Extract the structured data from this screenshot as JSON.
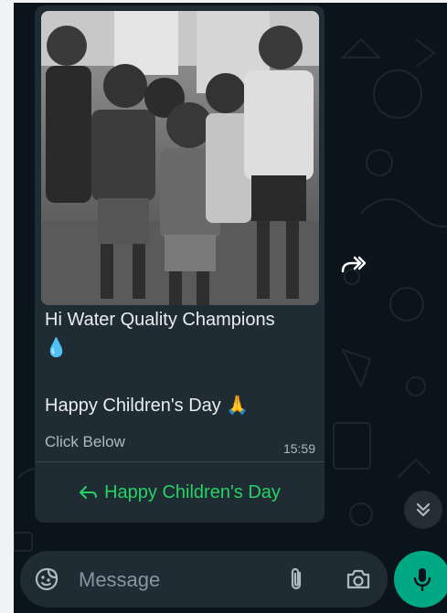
{
  "message": {
    "line1": "Hi Water Quality Champions",
    "line2_emoji": "💧",
    "line3": "Happy Children's Day 🙏",
    "footer": "Click Below",
    "time": "15:59",
    "quick_reply": "Happy Children's Day"
  },
  "composer": {
    "placeholder": "Message"
  },
  "icons": {
    "forward": "forward-icon",
    "scroll_down": "double-chevron-down-icon",
    "sticker": "sticker-icon",
    "attach": "paperclip-icon",
    "camera": "camera-icon",
    "mic": "microphone-icon",
    "reply": "reply-arrow-icon"
  },
  "colors": {
    "chat_background": "#0b141a",
    "bubble": "#202c33",
    "accent_green": "#25d366",
    "mic_button": "#00a884",
    "text": "#e9edef",
    "secondary_text": "#aebac1"
  }
}
